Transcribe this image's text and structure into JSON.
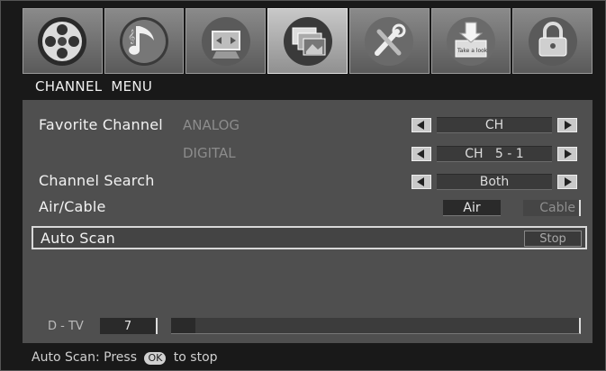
{
  "top_icons": [
    {
      "name": "picture-reel-icon"
    },
    {
      "name": "music-note-icon"
    },
    {
      "name": "screen-adjust-icon"
    },
    {
      "name": "channel-icon",
      "active": true
    },
    {
      "name": "tools-icon"
    },
    {
      "name": "take-a-look-icon",
      "caption": "Take a look"
    },
    {
      "name": "lock-icon"
    }
  ],
  "breadcrumb": {
    "section": "CHANNEL",
    "page": "MENU"
  },
  "rows": {
    "favorite_label": "Favorite Channel",
    "analog_label": "ANALOG",
    "analog_value": "CH",
    "digital_label": "DIGITAL",
    "digital_value": "CH   5 - 1",
    "search_label": "Channel Search",
    "search_value": "Both",
    "aircable_label": "Air/Cable",
    "air_option": "Air",
    "cable_option": "Cable",
    "autoscan_label": "Auto Scan",
    "stop_button": "Stop"
  },
  "scan": {
    "dtv_label": "D - TV",
    "channel": "7",
    "progress": 0.06
  },
  "footer": {
    "before": "Auto Scan: Press",
    "key": "OK",
    "after": "to stop"
  },
  "colors": {
    "panel": "#4f4f4f",
    "highlight_border": "#d8d8d8"
  }
}
